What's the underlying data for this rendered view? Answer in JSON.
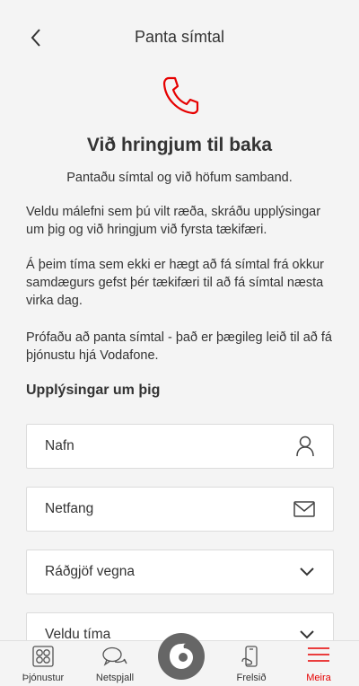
{
  "header": {
    "title": "Panta símtal",
    "back_icon": "chevron-left-icon"
  },
  "hero": {
    "icon": "phone-icon",
    "accent_color": "#e60000",
    "headline": "Við hringjum til baka",
    "subline": "Pantaðu símtal og við höfum samband."
  },
  "body": {
    "paragraph1": "Veldu málefni sem þú vilt ræða, skráðu upplýsingar um þig og við hringjum við fyrsta tækifæri.",
    "paragraph2": "Á þeim tíma sem ekki er hægt að fá símtal frá okkur samdægurs gefst þér tækifæri til að fá símtal næsta virka dag.",
    "paragraph3": "Prófaðu að panta símtal - það er þægileg leið til að fá þjónustu hjá Vodafone."
  },
  "form": {
    "section_title": "Upplýsingar um þig",
    "name": {
      "placeholder": "Nafn",
      "icon": "person-icon"
    },
    "email": {
      "placeholder": "Netfang",
      "icon": "envelope-icon"
    },
    "advice": {
      "label": "Ráðgjöf vegna",
      "icon": "chevron-down-icon"
    },
    "time": {
      "label": "Veldu tíma",
      "icon": "chevron-down-icon"
    }
  },
  "tabbar": {
    "items": [
      {
        "label": "Þjónustur",
        "icon": "grid-icon"
      },
      {
        "label": "Netspjall",
        "icon": "chat-bubbles-icon"
      },
      {
        "label": "",
        "icon": "vodafone-logo-icon"
      },
      {
        "label": "Frelsið",
        "icon": "phone-topup-icon"
      },
      {
        "label": "Meira",
        "icon": "hamburger-menu-icon",
        "active": true
      }
    ],
    "active_color": "#e60000"
  }
}
